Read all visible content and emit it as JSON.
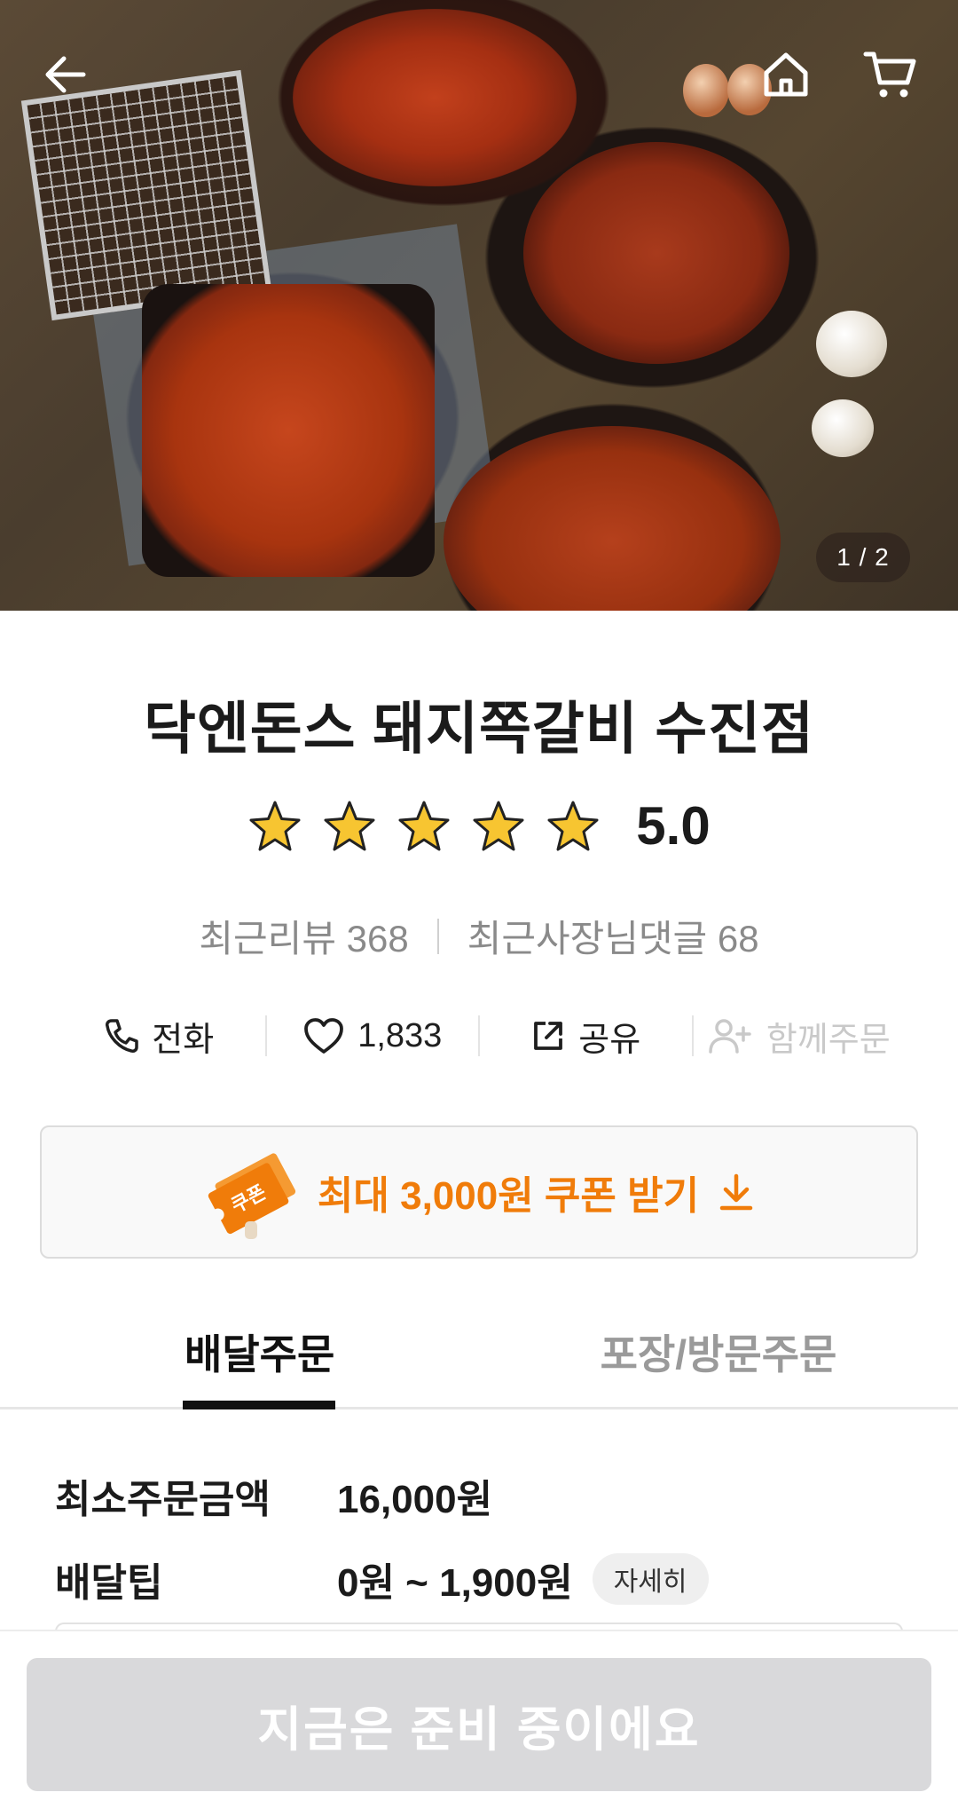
{
  "hero": {
    "image_counter": "1 / 2",
    "icons": {
      "back": "arrow-left-icon",
      "home": "home-icon",
      "cart": "cart-icon"
    }
  },
  "store": {
    "name": "닥엔돈스 돼지쪽갈비 수진점",
    "stars": 5,
    "rating": "5.0",
    "recent_reviews": "최근리뷰 368",
    "owner_replies": "최근사장님댓글 68"
  },
  "actions": {
    "call": "전화",
    "likes": "1,833",
    "share": "공유",
    "group_order": "함께주문"
  },
  "coupon": {
    "badge": "쿠폰",
    "text": "최대 3,000원 쿠폰 받기",
    "color": "#f07c0a"
  },
  "tabs": {
    "delivery": "배달주문",
    "pickup": "포장/방문주문"
  },
  "info": {
    "min_order_label": "최소주문금액",
    "min_order_value": "16,000원",
    "delivery_tip_label": "배달팁",
    "delivery_tip_value": "0원 ~ 1,900원",
    "detail_button": "자세히"
  },
  "cta": {
    "label": "지금은 준비 중이에요"
  }
}
